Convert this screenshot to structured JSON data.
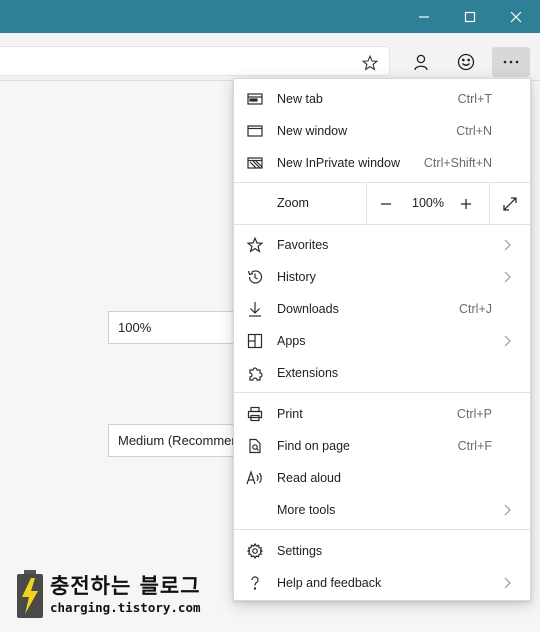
{
  "window_controls": {
    "minimize_icon": "minimize-icon",
    "maximize_icon": "maximize-icon",
    "close_icon": "close-icon",
    "titlebar_color": "#2f7f96"
  },
  "toolbar": {
    "favorite_icon": "star-outline-icon",
    "profile_icon": "person-icon",
    "feedback_icon": "smiley-icon",
    "more_icon": "ellipsis-icon"
  },
  "page": {
    "zoom_field_value": "100%",
    "text_size_field_value": "Medium (Recommended)"
  },
  "watermark": {
    "title": "충전하는 블로그",
    "subtitle": "charging.tistory.com"
  },
  "menu": {
    "group1": [
      {
        "label": "New tab",
        "shortcut": "Ctrl+T",
        "icon": "new-tab-icon"
      },
      {
        "label": "New window",
        "shortcut": "Ctrl+N",
        "icon": "new-window-icon"
      },
      {
        "label": "New InPrivate window",
        "shortcut": "Ctrl+Shift+N",
        "icon": "inprivate-icon"
      }
    ],
    "zoom": {
      "label": "Zoom",
      "value": "100%",
      "decrease_icon": "minus-icon",
      "increase_icon": "plus-icon",
      "fullscreen_icon": "fullscreen-icon"
    },
    "group2": [
      {
        "label": "Favorites",
        "icon": "star-icon",
        "submenu": true
      },
      {
        "label": "History",
        "icon": "history-icon",
        "submenu": true
      },
      {
        "label": "Downloads",
        "shortcut": "Ctrl+J",
        "icon": "download-icon"
      },
      {
        "label": "Apps",
        "icon": "apps-icon",
        "submenu": true
      },
      {
        "label": "Extensions",
        "icon": "extensions-icon"
      }
    ],
    "group3": [
      {
        "label": "Print",
        "shortcut": "Ctrl+P",
        "icon": "print-icon"
      },
      {
        "label": "Find on page",
        "shortcut": "Ctrl+F",
        "icon": "find-icon"
      },
      {
        "label": "Read aloud",
        "icon": "read-aloud-icon"
      },
      {
        "label": "More tools",
        "submenu": true
      }
    ],
    "group4": [
      {
        "label": "Settings",
        "icon": "gear-icon"
      },
      {
        "label": "Help and feedback",
        "icon": "question-icon",
        "submenu": true
      }
    ]
  }
}
